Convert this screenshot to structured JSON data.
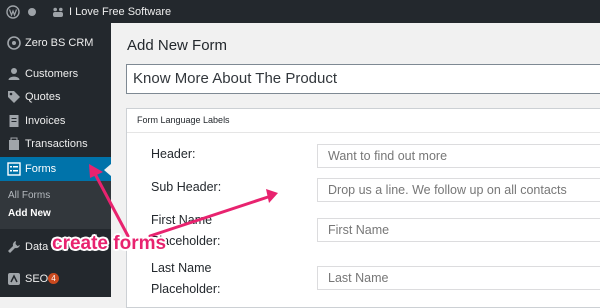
{
  "admin_bar": {
    "site_name": "I Love Free Software",
    "icons": [
      "wordpress-icon",
      "circle-icon",
      "home-icon"
    ]
  },
  "sidebar": {
    "header": {
      "label": "Zero BS CRM",
      "icon": "crm-icon"
    },
    "items": [
      {
        "label": "Customers",
        "icon": "person-icon"
      },
      {
        "label": "Quotes",
        "icon": "tag-icon"
      },
      {
        "label": "Invoices",
        "icon": "invoice-icon"
      },
      {
        "label": "Transactions",
        "icon": "cart-icon"
      },
      {
        "label": "Forms",
        "icon": "forms-icon",
        "active": true
      }
    ],
    "submenu": [
      {
        "label": "All Forms"
      },
      {
        "label": "Add New",
        "current": true
      }
    ],
    "lower_items": [
      {
        "label": "Data",
        "icon": "wrench-icon"
      },
      {
        "label": "SEO",
        "icon": "seo-icon",
        "badge": "4"
      }
    ]
  },
  "main": {
    "page_title": "Add New Form",
    "form_name_value": "Know More About The Product",
    "labels_box": {
      "title": "Form Language Labels",
      "fields": [
        {
          "label": "Header:",
          "placeholder": "Want to find out more"
        },
        {
          "label": "Sub Header:",
          "placeholder": "Drop us a line. We follow up on all contacts"
        },
        {
          "label": "First Name Placeholder:",
          "label_lines": [
            "First Name",
            "Placeholder:"
          ],
          "placeholder": "First Name"
        },
        {
          "label": "Last Name Placeholder:",
          "label_lines": [
            "Last Name",
            "Placeholder:"
          ],
          "placeholder": "Last Name"
        }
      ]
    }
  },
  "annotation": {
    "text": "create forms",
    "color": "#e8236f"
  },
  "colors": {
    "sidebar_bg": "#23282d",
    "active_bg": "#0073aa",
    "submenu_bg": "#32373c",
    "badge": "#ca4a1f"
  }
}
